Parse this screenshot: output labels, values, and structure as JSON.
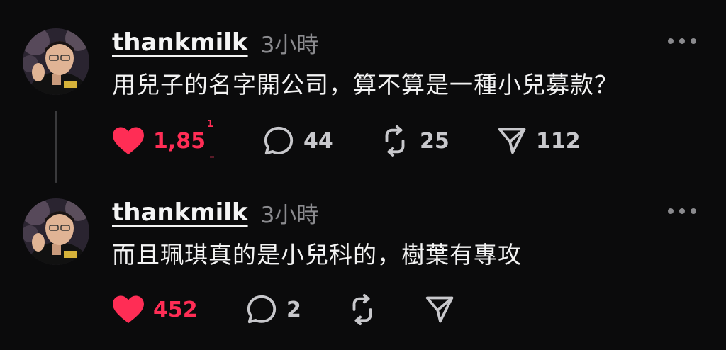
{
  "posts": [
    {
      "username": "thankmilk",
      "time": "3小時",
      "text": "用兒子的名字開公司，算不算是一種小兒募款？",
      "likes": "1,85",
      "likes_superscript": "1",
      "replies": "44",
      "reposts": "25",
      "shares": "112",
      "liked": true
    },
    {
      "username": "thankmilk",
      "time": "3小時",
      "text": "而且珮琪真的是小兒科的，樹葉有專攻",
      "likes": "452",
      "replies": "2",
      "reposts": "",
      "shares": "",
      "liked": true
    }
  ],
  "icons": {
    "like": "heart-icon",
    "reply": "comment-icon",
    "repost": "repost-icon",
    "share": "send-icon",
    "more": "more-icon"
  },
  "colors": {
    "background": "#0b0b0c",
    "liked": "#ff2d55",
    "muted": "#8a8a8e",
    "text": "#f3f3f3"
  }
}
